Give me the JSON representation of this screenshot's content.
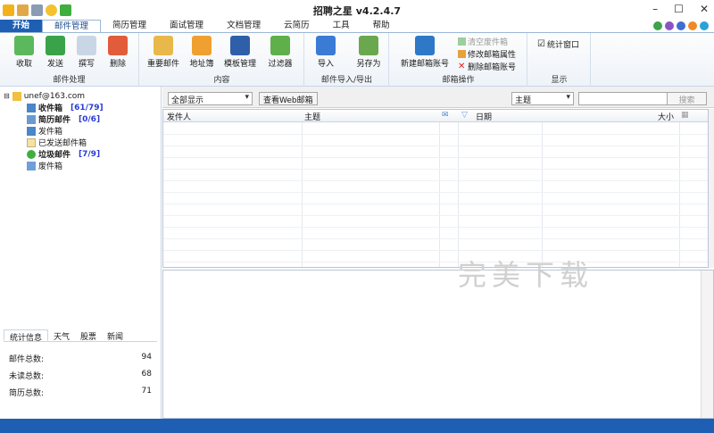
{
  "app": {
    "title": "招聘之星 v4.2.4.7"
  },
  "tabs": [
    "开始",
    "邮件管理",
    "简历管理",
    "面试管理",
    "文档管理",
    "云简历",
    "工具",
    "帮助"
  ],
  "ribbon": {
    "mail_group": {
      "label": "邮件处理",
      "buttons": [
        "收取",
        "发送",
        "撰写",
        "删除"
      ]
    },
    "content_group": {
      "label": "内容",
      "buttons": [
        "重要邮件",
        "地址簿",
        "模板管理",
        "过滤器"
      ]
    },
    "io_group": {
      "label": "邮件导入/导出",
      "buttons": [
        "导入",
        "另存为"
      ]
    },
    "mailbox_group": {
      "label": "邮箱操作",
      "new_account": "新建邮箱账号",
      "small": [
        "清空废件箱",
        "修改邮箱属性",
        "删除邮箱账号"
      ]
    },
    "display_group": {
      "label": "显示",
      "checkbox": "统计窗口"
    }
  },
  "tree": {
    "account": "unef@163.com",
    "folders": [
      {
        "label": "收件箱",
        "count": "[61/79]",
        "bold": true
      },
      {
        "label": "简历邮件",
        "count": "[0/6]",
        "bold": true
      },
      {
        "label": "发件箱",
        "count": ""
      },
      {
        "label": "已发送邮件箱",
        "count": ""
      },
      {
        "label": "垃圾邮件",
        "count": "[7/9]",
        "bold": true
      },
      {
        "label": "废件箱",
        "count": ""
      }
    ]
  },
  "stat_tabs": [
    "统计信息",
    "天气",
    "股票",
    "新闻"
  ],
  "stats": [
    {
      "label": "邮件总数:",
      "value": "94"
    },
    {
      "label": "未读总数:",
      "value": "68"
    },
    {
      "label": "简历总数:",
      "value": "71"
    }
  ],
  "filter": {
    "display": "全部显示",
    "web_btn": "查看Web邮箱",
    "search_field": "主题",
    "search_btn": "搜索"
  },
  "columns": {
    "sender": "发件人",
    "subject": "主题",
    "date": "日期",
    "size": "大小"
  },
  "watermark": "完美下载"
}
